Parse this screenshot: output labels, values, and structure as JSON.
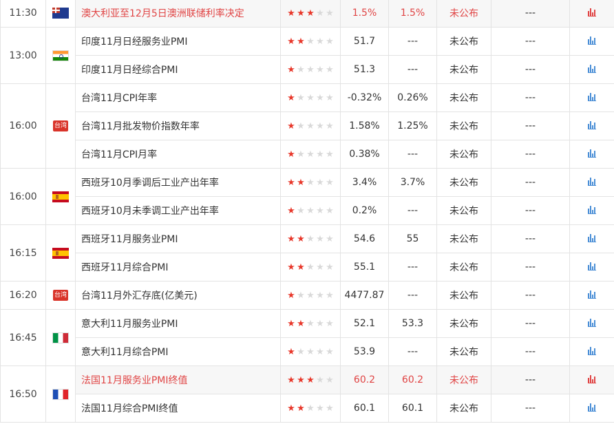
{
  "rows": [
    {
      "group_start": true,
      "rowspan": 1,
      "time": "11:30",
      "flag": "au",
      "flag_text": "",
      "event": "澳大利亚至12月5日澳洲联储利率决定",
      "stars": 3,
      "actual": "1.5%",
      "forecast": "1.5%",
      "status": "未公布",
      "extra": "---",
      "highlight": true
    },
    {
      "group_start": true,
      "rowspan": 2,
      "time": "13:00",
      "flag": "in",
      "flag_text": "",
      "event": "印度11月日经服务业PMI",
      "stars": 2,
      "actual": "51.7",
      "forecast": "---",
      "status": "未公布",
      "extra": "---",
      "highlight": false
    },
    {
      "group_start": false,
      "event": "印度11月日经综合PMI",
      "stars": 1,
      "actual": "51.3",
      "forecast": "---",
      "status": "未公布",
      "extra": "---",
      "highlight": false
    },
    {
      "group_start": true,
      "rowspan": 3,
      "time": "16:00",
      "flag": "tw",
      "flag_text": "台湾",
      "event": "台湾11月CPI年率",
      "stars": 1,
      "actual": "-0.32%",
      "forecast": "0.26%",
      "status": "未公布",
      "extra": "---",
      "highlight": false
    },
    {
      "group_start": false,
      "event": "台湾11月批发物价指数年率",
      "stars": 1,
      "actual": "1.58%",
      "forecast": "1.25%",
      "status": "未公布",
      "extra": "---",
      "highlight": false
    },
    {
      "group_start": false,
      "event": "台湾11月CPI月率",
      "stars": 1,
      "actual": "0.38%",
      "forecast": "---",
      "status": "未公布",
      "extra": "---",
      "highlight": false
    },
    {
      "group_start": true,
      "rowspan": 2,
      "time": "16:00",
      "flag": "es",
      "flag_text": "",
      "event": "西班牙10月季调后工业产出年率",
      "stars": 2,
      "actual": "3.4%",
      "forecast": "3.7%",
      "status": "未公布",
      "extra": "---",
      "highlight": false
    },
    {
      "group_start": false,
      "event": "西班牙10月未季调工业产出年率",
      "stars": 1,
      "actual": "0.2%",
      "forecast": "---",
      "status": "未公布",
      "extra": "---",
      "highlight": false
    },
    {
      "group_start": true,
      "rowspan": 2,
      "time": "16:15",
      "flag": "es",
      "flag_text": "",
      "event": "西班牙11月服务业PMI",
      "stars": 2,
      "actual": "54.6",
      "forecast": "55",
      "status": "未公布",
      "extra": "---",
      "highlight": false
    },
    {
      "group_start": false,
      "event": "西班牙11月综合PMI",
      "stars": 2,
      "actual": "55.1",
      "forecast": "---",
      "status": "未公布",
      "extra": "---",
      "highlight": false
    },
    {
      "group_start": true,
      "rowspan": 1,
      "time": "16:20",
      "flag": "tw",
      "flag_text": "台湾",
      "event": "台湾11月外汇存底(亿美元)",
      "stars": 1,
      "actual": "4477.87",
      "forecast": "---",
      "status": "未公布",
      "extra": "---",
      "highlight": false
    },
    {
      "group_start": true,
      "rowspan": 2,
      "time": "16:45",
      "flag": "it",
      "flag_text": "",
      "event": "意大利11月服务业PMI",
      "stars": 2,
      "actual": "52.1",
      "forecast": "53.3",
      "status": "未公布",
      "extra": "---",
      "highlight": false
    },
    {
      "group_start": false,
      "event": "意大利11月综合PMI",
      "stars": 1,
      "actual": "53.9",
      "forecast": "---",
      "status": "未公布",
      "extra": "---",
      "highlight": false
    },
    {
      "group_start": true,
      "rowspan": 2,
      "time": "16:50",
      "flag": "fr",
      "flag_text": "",
      "event": "法国11月服务业PMI终值",
      "stars": 3,
      "actual": "60.2",
      "forecast": "60.2",
      "status": "未公布",
      "extra": "---",
      "highlight": true
    },
    {
      "group_start": false,
      "event": "法国11月综合PMI终值",
      "stars": 2,
      "actual": "60.1",
      "forecast": "60.1",
      "status": "未公布",
      "extra": "---",
      "highlight": false
    }
  ],
  "max_stars": 5,
  "colors": {
    "highlight": "#e04444",
    "star_on": "#e8382b",
    "star_off": "#d9d9d9",
    "chart_icon": "#4a8ed6"
  }
}
